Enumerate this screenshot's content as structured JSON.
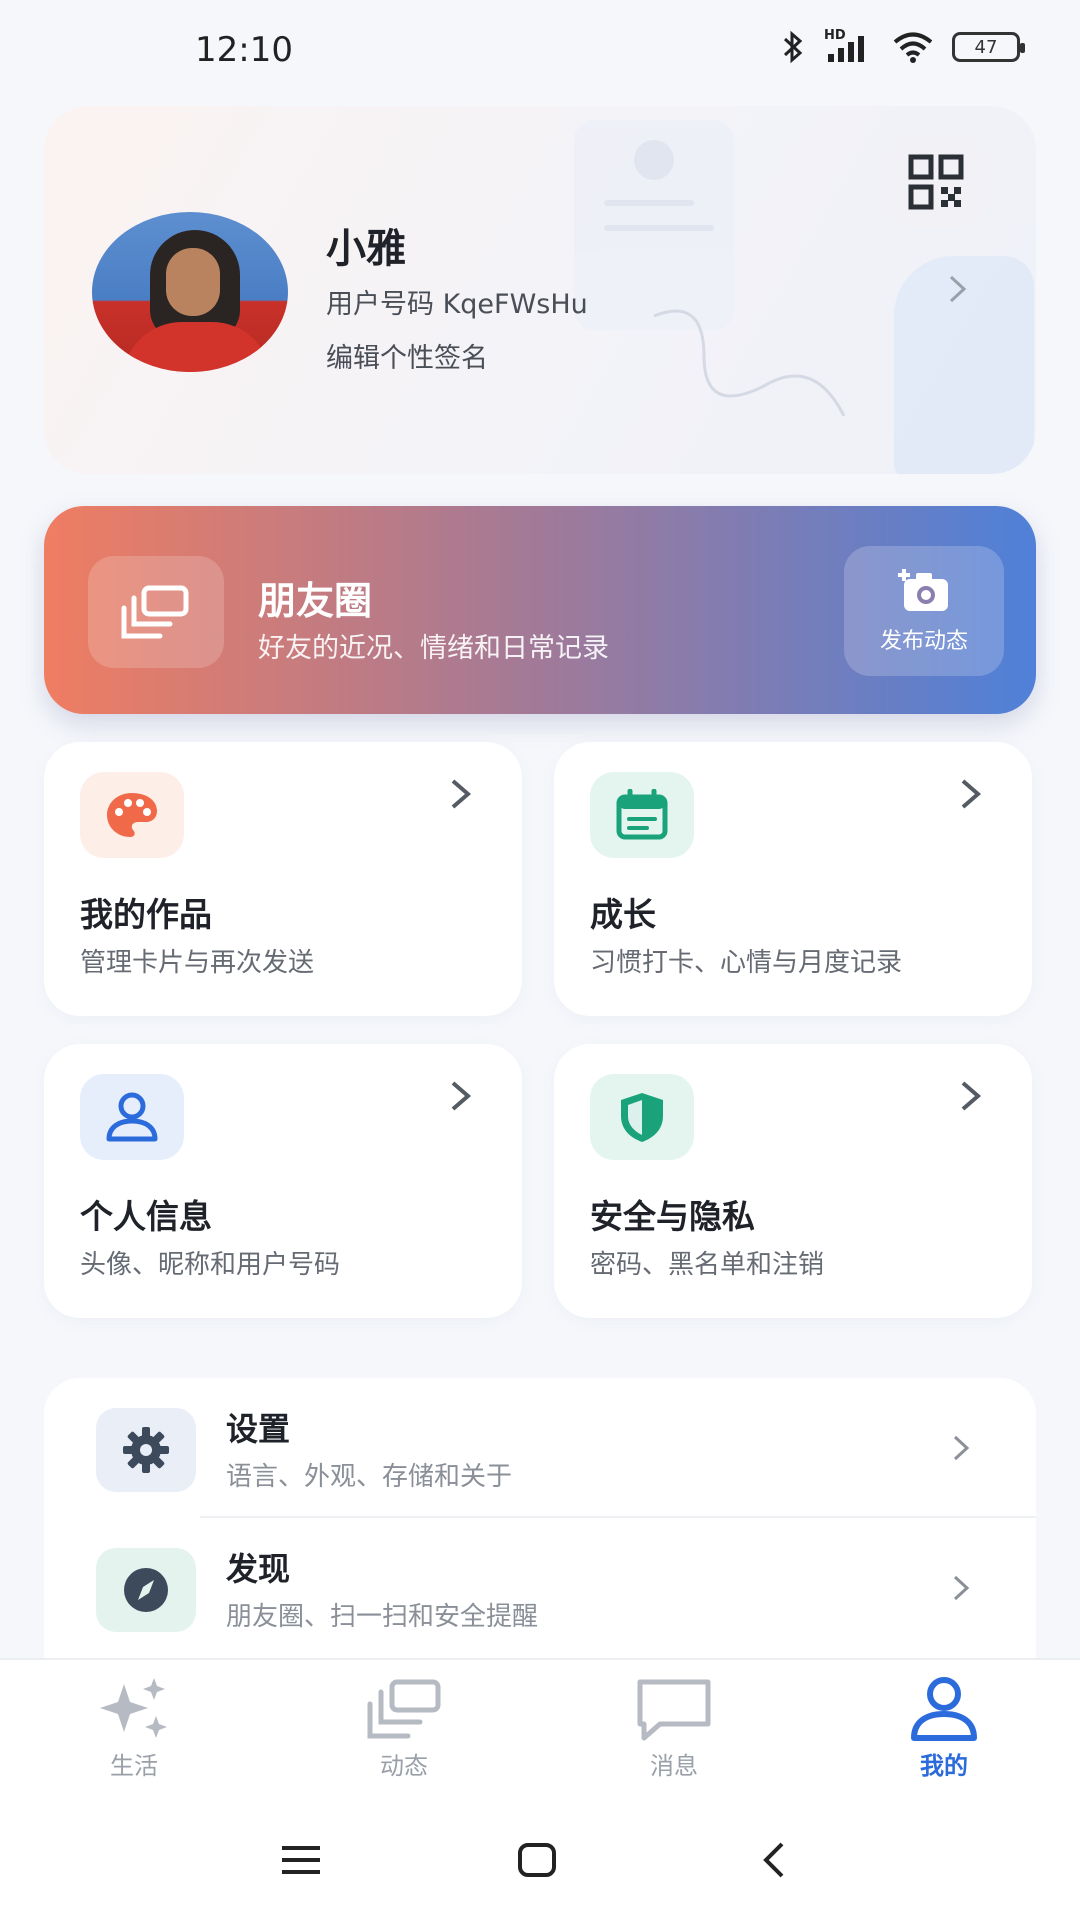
{
  "status_bar": {
    "time": "12:10",
    "battery": "47",
    "network": "HD"
  },
  "profile": {
    "name": "小雅",
    "user_id": "用户号码 KqeFWsHu",
    "signature": "编辑个性签名"
  },
  "moments": {
    "title": "朋友圈",
    "subtitle": "好友的近况、情绪和日常记录",
    "post_label": "发布动态"
  },
  "cards": [
    {
      "title": "我的作品",
      "subtitle": "管理卡片与再次发送",
      "icon": "palette-icon",
      "color": "#f06a4a"
    },
    {
      "title": "成长",
      "subtitle": "习惯打卡、心情与月度记录",
      "icon": "calendar-icon",
      "color": "#1aa37a"
    },
    {
      "title": "个人信息",
      "subtitle": "头像、昵称和用户号码",
      "icon": "user-icon",
      "color": "#2c6bdc"
    },
    {
      "title": "安全与隐私",
      "subtitle": "密码、黑名单和注销",
      "icon": "shield-icon",
      "color": "#1aa37a"
    }
  ],
  "list": [
    {
      "title": "设置",
      "subtitle": "语言、外观、存储和关于",
      "icon": "gear-icon"
    },
    {
      "title": "发现",
      "subtitle": "朋友圈、扫一扫和安全提醒",
      "icon": "compass-icon"
    }
  ],
  "tabs": [
    {
      "label": "生活",
      "icon": "sparkle-icon",
      "active": false
    },
    {
      "label": "动态",
      "icon": "layers-icon",
      "active": false
    },
    {
      "label": "消息",
      "icon": "chat-icon",
      "active": false
    },
    {
      "label": "我的",
      "icon": "user-icon",
      "active": true
    }
  ],
  "colors": {
    "accent": "#2c6bdc",
    "banner_start": "#ef7d62",
    "banner_end": "#4f80d8"
  }
}
